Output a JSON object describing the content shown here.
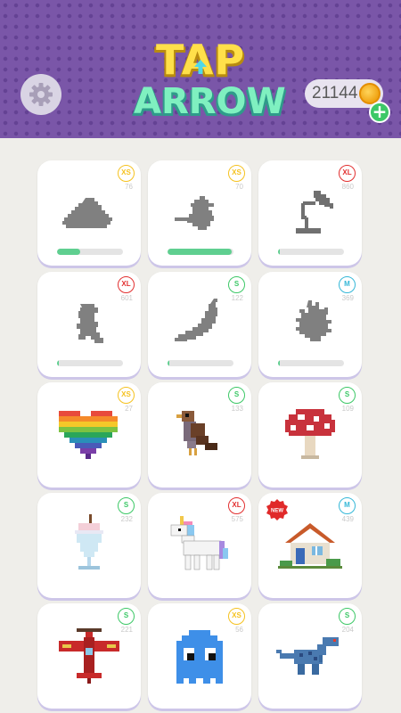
{
  "header": {
    "logo_line1": "TAP",
    "logo_line2": "ARROW",
    "coins": "21144",
    "plus": "+"
  },
  "colors": {
    "header_bg": "#7a56a8",
    "background": "#efeeea",
    "progress_fill": "#5fcf90",
    "badge_xs": "#f5c220",
    "badge_s": "#3dc867",
    "badge_m": "#36b8d8",
    "badge_xl": "#e23030"
  },
  "levels": [
    {
      "name": "pile",
      "size": "XS",
      "count": "76",
      "progress": 0.35,
      "silhouette": true
    },
    {
      "name": "bird-silhouette",
      "size": "XS",
      "count": "70",
      "progress": 0.97,
      "silhouette": true
    },
    {
      "name": "lamp",
      "size": "XL",
      "count": "860",
      "progress": 0.02,
      "silhouette": true
    },
    {
      "name": "mario",
      "size": "XL",
      "count": "601",
      "progress": 0.02,
      "silhouette": true
    },
    {
      "name": "chili",
      "size": "S",
      "count": "122",
      "progress": 0.02,
      "silhouette": true
    },
    {
      "name": "splash",
      "size": "M",
      "count": "369",
      "progress": 0.02,
      "silhouette": true
    },
    {
      "name": "rainbow-heart",
      "size": "XS",
      "count": "27",
      "silhouette": false
    },
    {
      "name": "sparrow",
      "size": "S",
      "count": "133",
      "silhouette": false
    },
    {
      "name": "mushroom",
      "size": "S",
      "count": "109",
      "silhouette": false
    },
    {
      "name": "milkshake",
      "size": "S",
      "count": "232",
      "silhouette": false
    },
    {
      "name": "unicorn",
      "size": "XL",
      "count": "575",
      "silhouette": false
    },
    {
      "name": "house",
      "size": "M",
      "count": "439",
      "silhouette": false,
      "new_label": "NEW"
    },
    {
      "name": "airplane",
      "size": "S",
      "count": "221",
      "silhouette": false
    },
    {
      "name": "ghost",
      "size": "XS",
      "count": "56",
      "silhouette": false
    },
    {
      "name": "dinosaur",
      "size": "S",
      "count": "204",
      "silhouette": false
    }
  ]
}
